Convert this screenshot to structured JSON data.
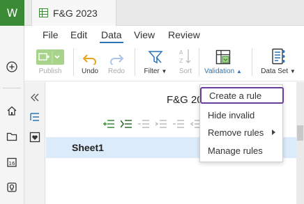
{
  "app": {
    "logo_letter": "W",
    "brand_color": "#3a8a35"
  },
  "tab": {
    "title": "F&G 2023"
  },
  "menu": {
    "items": [
      "File",
      "Edit",
      "Data",
      "View",
      "Review"
    ],
    "active": "Data"
  },
  "ribbon": {
    "publish": "Publish",
    "undo": "Undo",
    "redo": "Redo",
    "filter": "Filter",
    "sort": "Sort",
    "validation": "Validation",
    "dataset": "Data Set"
  },
  "sheet": {
    "title": "F&G 2023",
    "row_label": "Sheet1"
  },
  "validation_menu": {
    "items": [
      "Create a rule",
      "Hide invalid",
      "Remove rules",
      "Manage rules"
    ],
    "highlighted": "Create a rule",
    "highlight_color": "#6a3d9a"
  },
  "icons": {
    "rail": [
      "plus-circle-icon",
      "home-icon",
      "folder-icon",
      "calendar-icon",
      "bulb-icon"
    ],
    "strip": [
      "collapse-left-icon",
      "tree-list-icon",
      "favorite-sheet-icon"
    ]
  }
}
